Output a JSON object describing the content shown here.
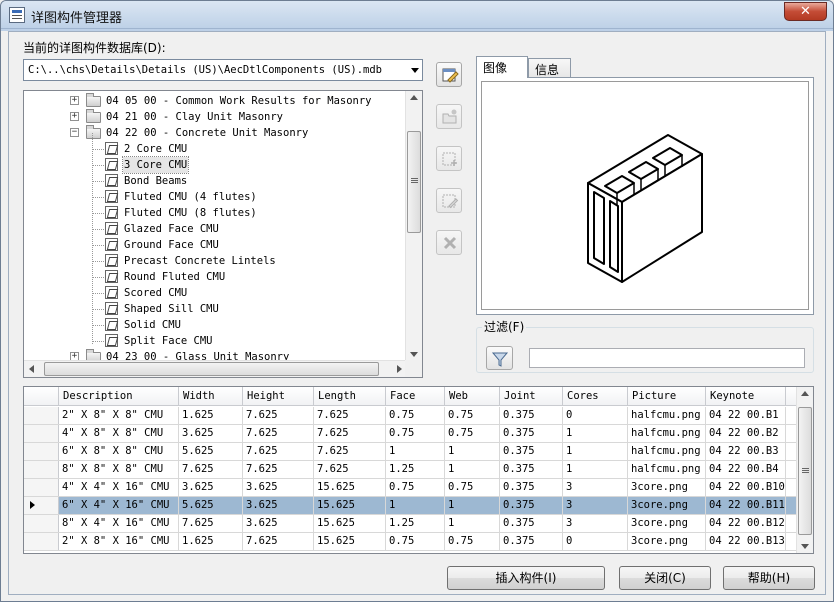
{
  "window": {
    "title": "详图构件管理器",
    "close_glyph": "✕"
  },
  "database": {
    "label": "当前的详图构件数据库(D):",
    "path": "C:\\..\\chs\\Details\\Details (US)\\AecDtlComponents (US).mdb"
  },
  "tree": {
    "items": [
      {
        "text": "04 05 00 - Common Work Results for Masonry",
        "kind": "folder",
        "expander": "+"
      },
      {
        "text": "04 21 00 - Clay Unit Masonry",
        "kind": "folder",
        "expander": "+"
      },
      {
        "text": "04 22 00 - Concrete Unit Masonry",
        "kind": "folder",
        "expander": "−"
      },
      {
        "text": "2 Core CMU",
        "kind": "component"
      },
      {
        "text": "3 Core CMU",
        "kind": "component",
        "selected": true
      },
      {
        "text": "Bond Beams",
        "kind": "component"
      },
      {
        "text": "Fluted CMU (4 flutes)",
        "kind": "component"
      },
      {
        "text": "Fluted CMU (8 flutes)",
        "kind": "component"
      },
      {
        "text": "Glazed Face CMU",
        "kind": "component"
      },
      {
        "text": "Ground Face CMU",
        "kind": "component"
      },
      {
        "text": "Precast Concrete Lintels",
        "kind": "component"
      },
      {
        "text": "Round Fluted CMU",
        "kind": "component"
      },
      {
        "text": "Scored CMU",
        "kind": "component"
      },
      {
        "text": "Shaped Sill CMU",
        "kind": "component"
      },
      {
        "text": "Solid CMU",
        "kind": "component"
      },
      {
        "text": "Split Face CMU",
        "kind": "component"
      },
      {
        "text": "04 23 00 - Glass Unit Masonry",
        "kind": "folder",
        "expander": "+"
      }
    ]
  },
  "tabs": [
    {
      "label": "图像",
      "active": true
    },
    {
      "label": "信息",
      "active": false
    }
  ],
  "filter": {
    "label": "过滤(F)",
    "value": ""
  },
  "grid": {
    "columns": [
      "Description",
      "Width",
      "Height",
      "Length",
      "Face",
      "Web",
      "Joint",
      "Cores",
      "Picture",
      "Keynote"
    ],
    "rows": [
      [
        "2\" X 8\" X 8\" CMU",
        "1.625",
        "7.625",
        "7.625",
        "0.75",
        "0.75",
        "0.375",
        "0",
        "halfcmu.png",
        "04 22 00.B1"
      ],
      [
        "4\" X 8\" X 8\" CMU",
        "3.625",
        "7.625",
        "7.625",
        "0.75",
        "0.75",
        "0.375",
        "1",
        "halfcmu.png",
        "04 22 00.B2"
      ],
      [
        "6\" X 8\" X 8\" CMU",
        "5.625",
        "7.625",
        "7.625",
        "1",
        "1",
        "0.375",
        "1",
        "halfcmu.png",
        "04 22 00.B3"
      ],
      [
        "8\" X 8\" X 8\" CMU",
        "7.625",
        "7.625",
        "7.625",
        "1.25",
        "1",
        "0.375",
        "1",
        "halfcmu.png",
        "04 22 00.B4"
      ],
      [
        "4\" X 4\" X 16\" CMU",
        "3.625",
        "3.625",
        "15.625",
        "0.75",
        "0.75",
        "0.375",
        "3",
        "3core.png",
        "04 22 00.B10"
      ],
      [
        "6\" X 4\" X 16\" CMU",
        "5.625",
        "3.625",
        "15.625",
        "1",
        "1",
        "0.375",
        "3",
        "3core.png",
        "04 22 00.B11"
      ],
      [
        "8\" X 4\" X 16\" CMU",
        "7.625",
        "3.625",
        "15.625",
        "1.25",
        "1",
        "0.375",
        "3",
        "3core.png",
        "04 22 00.B12"
      ],
      [
        "2\" X 8\" X 16\" CMU",
        "1.625",
        "7.625",
        "15.625",
        "0.75",
        "0.75",
        "0.375",
        "0",
        "3core.png",
        "04 22 00.B13"
      ]
    ],
    "selected_row": 5
  },
  "buttons": {
    "insert": "插入构件(I)",
    "close": "关闭(C)",
    "help": "帮助(H)"
  },
  "toolbar": {
    "icons": [
      "edit-database-icon",
      "open-database-icon",
      "new-component-icon",
      "edit-component-icon",
      "delete-icon"
    ]
  },
  "colors": {
    "selection": "#9db8d2",
    "close_red": "#c44c36"
  }
}
